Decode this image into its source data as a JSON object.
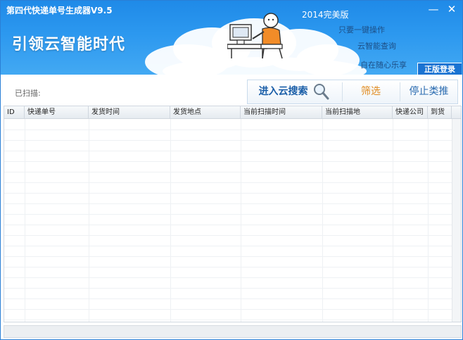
{
  "window": {
    "title": "第四代快递单号生成器V9.5",
    "minimize_glyph": "—",
    "close_glyph": "✕"
  },
  "banner": {
    "slogan": "引领云智能时代",
    "edition": "2014完美版",
    "features": [
      "只要一键操作",
      "云智能查询",
      "自在随心乐享"
    ],
    "login_label": "正版登录"
  },
  "scan": {
    "label": "已扫描:"
  },
  "toolbar": {
    "cloud_search_label": "进入云搜索",
    "filter_label": "筛选",
    "stop_label": "停止类推"
  },
  "table": {
    "columns": [
      "ID",
      "快递单号",
      "发货时间",
      "发货地点",
      "当前扫描时间",
      "当前扫描地",
      "快递公司",
      "到货"
    ],
    "rows": []
  },
  "colors": {
    "banner_blue": "#2c98ef",
    "login_blue": "#1a73d2",
    "cloud_search_text": "#1a5ea8",
    "filter_text": "#e08a1e",
    "stop_text": "#2a6bb0"
  },
  "icons": {
    "cloud_search": "magnifier-icon",
    "mascot": "mascot-illustration"
  }
}
